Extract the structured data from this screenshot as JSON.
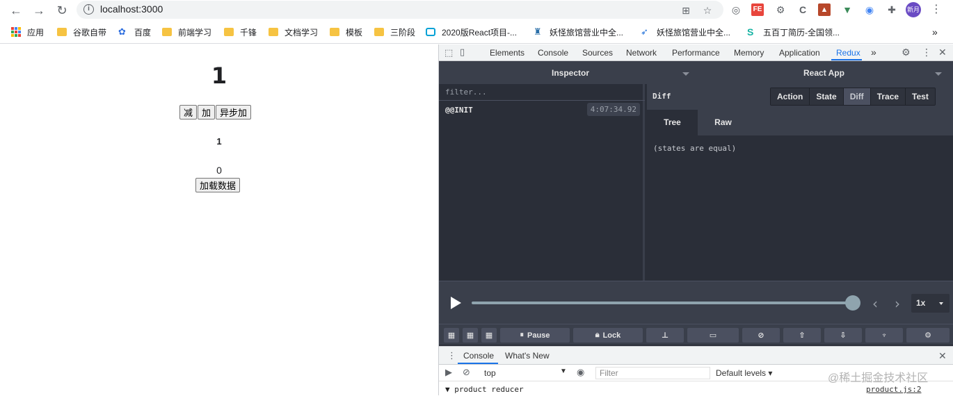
{
  "browser": {
    "url": "localhost:3000",
    "bookmarks": [
      {
        "label": "应用",
        "icon": "apps-grid-icon"
      },
      {
        "label": "谷歌自带",
        "icon": "folder-icon"
      },
      {
        "label": "百度",
        "icon": "baidu-paw-icon"
      },
      {
        "label": "前端学习",
        "icon": "folder-icon"
      },
      {
        "label": "千锋",
        "icon": "folder-icon"
      },
      {
        "label": "文档学习",
        "icon": "folder-icon"
      },
      {
        "label": "模板",
        "icon": "folder-icon"
      },
      {
        "label": "三阶段",
        "icon": "folder-icon"
      },
      {
        "label": "2020版React项目-...",
        "icon": "bilibili-icon"
      },
      {
        "label": "妖怪旅馆营业中全...",
        "icon": "site-icon"
      },
      {
        "label": "妖怪旅馆营业中全...",
        "icon": "site-icon"
      },
      {
        "label": "五百丁简历-全国领...",
        "icon": "site-icon"
      }
    ],
    "profile_label": "新月",
    "more_bookmarks": "»"
  },
  "app": {
    "count_big": "1",
    "btn_minus": "减",
    "btn_plus": "加",
    "btn_async": "异步加",
    "count_small": "1",
    "data_count": "0",
    "btn_load": "加载数据"
  },
  "devtools": {
    "tabs": [
      "Elements",
      "Console",
      "Sources",
      "Network",
      "Performance",
      "Memory",
      "Application",
      "Redux"
    ],
    "active_tab": "Redux",
    "more": "»",
    "redux": {
      "inspector_label": "Inspector",
      "instance_label": "React App",
      "filter_placeholder": "filter...",
      "actions": [
        {
          "name": "@@INIT",
          "time": "4:07:34.92"
        }
      ],
      "monitor_title": "Diff",
      "monitor_tabs": [
        "Action",
        "State",
        "Diff",
        "Trace",
        "Test"
      ],
      "active_monitor_tab": "Diff",
      "sub_tabs": [
        "Tree",
        "Raw"
      ],
      "active_sub_tab": "Tree",
      "diff_message": "(states are equal)",
      "speed": "1x",
      "toolbar": {
        "pause": "Pause",
        "lock": "Lock"
      }
    }
  },
  "console_drawer": {
    "tabs": [
      "Console",
      "What's New"
    ],
    "context": "top",
    "filter_placeholder": "Filter",
    "levels": "Default levels ▾",
    "message": "▼ product reducer",
    "source": "product.js:2"
  },
  "watermark": "@稀土掘金技术社区"
}
